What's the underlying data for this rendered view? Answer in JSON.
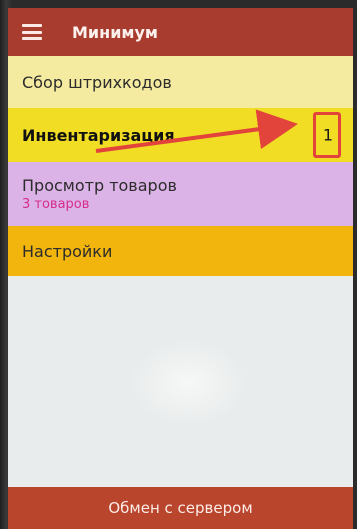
{
  "app_bar": {
    "title": "Минимум",
    "menu_icon": "hamburger-menu-icon"
  },
  "menu": {
    "items": [
      {
        "label": "Сбор штрихкодов",
        "color": "#f4eaa0"
      },
      {
        "label": "Инвентаризация",
        "badge": "1",
        "color": "#f0dd24"
      },
      {
        "label": "Просмотр товаров",
        "subtitle": "3 товаров",
        "color": "#dcb3e6"
      },
      {
        "label": "Настройки",
        "color": "#f2b50d"
      }
    ]
  },
  "footer": {
    "label": "Обмен с сервером"
  },
  "colors": {
    "app_bar": "#a83c2e",
    "footer": "#b9452d",
    "annotation": "#e2443b",
    "subtitle": "#d62d8c"
  }
}
